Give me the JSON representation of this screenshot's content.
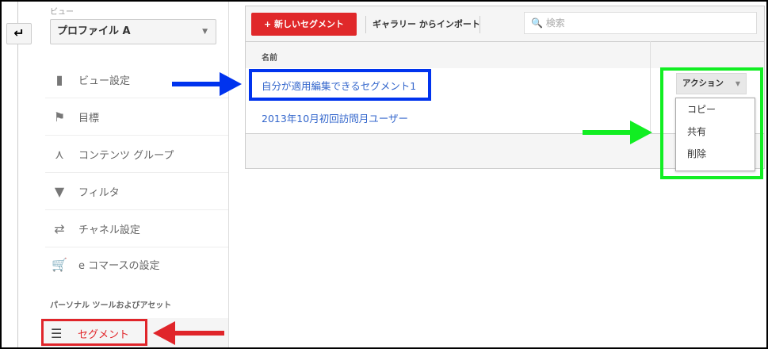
{
  "sidebar": {
    "back_icon": "back-arrow-icon",
    "view_label": "ビュー",
    "view_select": "プロファイル A",
    "items": [
      {
        "label": "ビュー設定",
        "icon": "document-icon"
      },
      {
        "label": "目標",
        "icon": "flag-icon"
      },
      {
        "label": "コンテンツ グループ",
        "icon": "content-group-icon"
      },
      {
        "label": "フィルタ",
        "icon": "filter-icon"
      },
      {
        "label": "チャネル設定",
        "icon": "channel-icon"
      },
      {
        "label": "e コマースの設定",
        "icon": "cart-icon"
      }
    ],
    "section_heading": "パーソナル ツールおよびアセット",
    "segment_item": "セグメント"
  },
  "toolbar": {
    "new_segment": "+ 新しいセグメント",
    "import_gallery": "ギャラリー からインポート",
    "search_placeholder": "検索"
  },
  "table": {
    "header_name": "名前",
    "rows": [
      "自分が適用編集できるセグメント1",
      "2013年10月初回訪問月ユーザー"
    ]
  },
  "actions": {
    "button": "アクション",
    "menu": [
      "コピー",
      "共有",
      "削除"
    ]
  },
  "colors": {
    "accent_red": "#e0282a",
    "link": "#3366cc",
    "annotation_blue": "#0033ee",
    "annotation_green": "#11ee22"
  }
}
